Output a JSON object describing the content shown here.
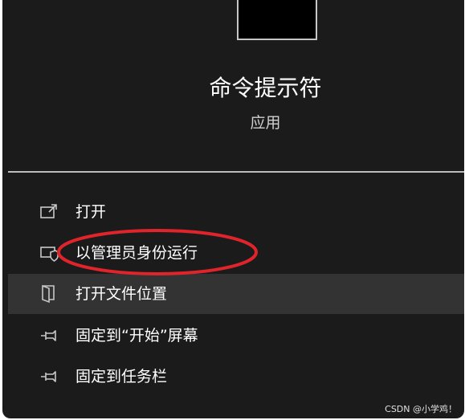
{
  "app": {
    "title": "命令提示符",
    "subtitle": "应用"
  },
  "menu": {
    "items": [
      {
        "label": "打开",
        "icon": "open-external-icon"
      },
      {
        "label": "以管理员身份运行",
        "icon": "run-as-admin-icon"
      },
      {
        "label": "打开文件位置",
        "icon": "file-location-icon"
      },
      {
        "label": "固定到“开始”屏幕",
        "icon": "pin-icon"
      },
      {
        "label": "固定到任务栏",
        "icon": "pin-icon"
      }
    ],
    "highlighted_index": 2
  },
  "annotation": {
    "color": "#e0242b",
    "target": "以管理员身份运行"
  },
  "watermark": "CSDN @小学鸡！",
  "colors": {
    "panel_bg": "#1b1b1b",
    "highlight_bg": "#333333",
    "text": "#ffffff",
    "icon_stroke": "#c8c8c8"
  }
}
